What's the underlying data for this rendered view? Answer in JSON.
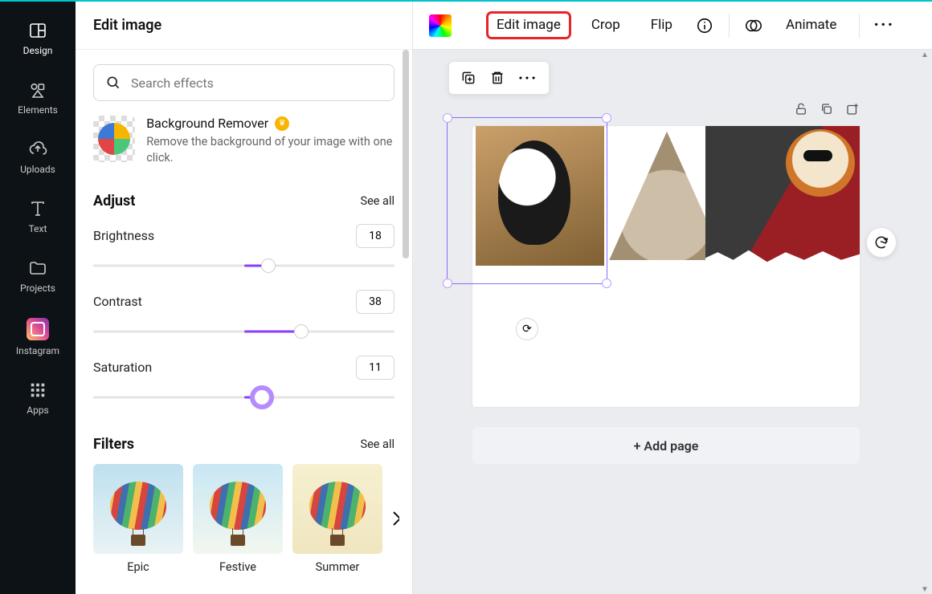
{
  "nav": {
    "items": [
      {
        "label": "Design"
      },
      {
        "label": "Elements"
      },
      {
        "label": "Uploads"
      },
      {
        "label": "Text"
      },
      {
        "label": "Projects"
      },
      {
        "label": "Instagram"
      },
      {
        "label": "Apps"
      }
    ]
  },
  "panel": {
    "title": "Edit image",
    "search_placeholder": "Search effects",
    "bg_remover": {
      "title": "Background Remover",
      "subtitle": "Remove the background of your image with one click."
    },
    "adjust": {
      "heading": "Adjust",
      "see_all": "See all",
      "sliders": [
        {
          "label": "Brightness",
          "value": "18",
          "percent": 58
        },
        {
          "label": "Contrast",
          "value": "38",
          "percent": 69
        },
        {
          "label": "Saturation",
          "value": "11",
          "percent": 56
        }
      ]
    },
    "filters": {
      "heading": "Filters",
      "see_all": "See all",
      "items": [
        {
          "name": "Epic"
        },
        {
          "name": "Festive"
        },
        {
          "name": "Summer"
        }
      ]
    }
  },
  "toolbar": {
    "edit_image": "Edit image",
    "crop": "Crop",
    "flip": "Flip",
    "animate": "Animate"
  },
  "canvas": {
    "add_page": "+ Add page"
  }
}
